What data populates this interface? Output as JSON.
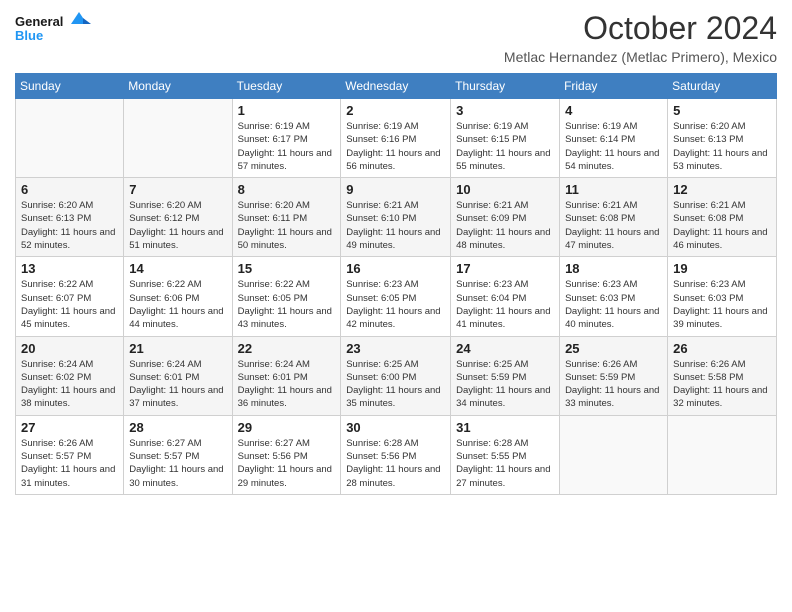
{
  "logo": {
    "line1": "General",
    "line2": "Blue"
  },
  "header": {
    "month": "October 2024",
    "subtitle": "Metlac Hernandez (Metlac Primero), Mexico"
  },
  "weekdays": [
    "Sunday",
    "Monday",
    "Tuesday",
    "Wednesday",
    "Thursday",
    "Friday",
    "Saturday"
  ],
  "weeks": [
    [
      {
        "day": "",
        "info": ""
      },
      {
        "day": "",
        "info": ""
      },
      {
        "day": "1",
        "info": "Sunrise: 6:19 AM\nSunset: 6:17 PM\nDaylight: 11 hours and 57 minutes."
      },
      {
        "day": "2",
        "info": "Sunrise: 6:19 AM\nSunset: 6:16 PM\nDaylight: 11 hours and 56 minutes."
      },
      {
        "day": "3",
        "info": "Sunrise: 6:19 AM\nSunset: 6:15 PM\nDaylight: 11 hours and 55 minutes."
      },
      {
        "day": "4",
        "info": "Sunrise: 6:19 AM\nSunset: 6:14 PM\nDaylight: 11 hours and 54 minutes."
      },
      {
        "day": "5",
        "info": "Sunrise: 6:20 AM\nSunset: 6:13 PM\nDaylight: 11 hours and 53 minutes."
      }
    ],
    [
      {
        "day": "6",
        "info": "Sunrise: 6:20 AM\nSunset: 6:13 PM\nDaylight: 11 hours and 52 minutes."
      },
      {
        "day": "7",
        "info": "Sunrise: 6:20 AM\nSunset: 6:12 PM\nDaylight: 11 hours and 51 minutes."
      },
      {
        "day": "8",
        "info": "Sunrise: 6:20 AM\nSunset: 6:11 PM\nDaylight: 11 hours and 50 minutes."
      },
      {
        "day": "9",
        "info": "Sunrise: 6:21 AM\nSunset: 6:10 PM\nDaylight: 11 hours and 49 minutes."
      },
      {
        "day": "10",
        "info": "Sunrise: 6:21 AM\nSunset: 6:09 PM\nDaylight: 11 hours and 48 minutes."
      },
      {
        "day": "11",
        "info": "Sunrise: 6:21 AM\nSunset: 6:08 PM\nDaylight: 11 hours and 47 minutes."
      },
      {
        "day": "12",
        "info": "Sunrise: 6:21 AM\nSunset: 6:08 PM\nDaylight: 11 hours and 46 minutes."
      }
    ],
    [
      {
        "day": "13",
        "info": "Sunrise: 6:22 AM\nSunset: 6:07 PM\nDaylight: 11 hours and 45 minutes."
      },
      {
        "day": "14",
        "info": "Sunrise: 6:22 AM\nSunset: 6:06 PM\nDaylight: 11 hours and 44 minutes."
      },
      {
        "day": "15",
        "info": "Sunrise: 6:22 AM\nSunset: 6:05 PM\nDaylight: 11 hours and 43 minutes."
      },
      {
        "day": "16",
        "info": "Sunrise: 6:23 AM\nSunset: 6:05 PM\nDaylight: 11 hours and 42 minutes."
      },
      {
        "day": "17",
        "info": "Sunrise: 6:23 AM\nSunset: 6:04 PM\nDaylight: 11 hours and 41 minutes."
      },
      {
        "day": "18",
        "info": "Sunrise: 6:23 AM\nSunset: 6:03 PM\nDaylight: 11 hours and 40 minutes."
      },
      {
        "day": "19",
        "info": "Sunrise: 6:23 AM\nSunset: 6:03 PM\nDaylight: 11 hours and 39 minutes."
      }
    ],
    [
      {
        "day": "20",
        "info": "Sunrise: 6:24 AM\nSunset: 6:02 PM\nDaylight: 11 hours and 38 minutes."
      },
      {
        "day": "21",
        "info": "Sunrise: 6:24 AM\nSunset: 6:01 PM\nDaylight: 11 hours and 37 minutes."
      },
      {
        "day": "22",
        "info": "Sunrise: 6:24 AM\nSunset: 6:01 PM\nDaylight: 11 hours and 36 minutes."
      },
      {
        "day": "23",
        "info": "Sunrise: 6:25 AM\nSunset: 6:00 PM\nDaylight: 11 hours and 35 minutes."
      },
      {
        "day": "24",
        "info": "Sunrise: 6:25 AM\nSunset: 5:59 PM\nDaylight: 11 hours and 34 minutes."
      },
      {
        "day": "25",
        "info": "Sunrise: 6:26 AM\nSunset: 5:59 PM\nDaylight: 11 hours and 33 minutes."
      },
      {
        "day": "26",
        "info": "Sunrise: 6:26 AM\nSunset: 5:58 PM\nDaylight: 11 hours and 32 minutes."
      }
    ],
    [
      {
        "day": "27",
        "info": "Sunrise: 6:26 AM\nSunset: 5:57 PM\nDaylight: 11 hours and 31 minutes."
      },
      {
        "day": "28",
        "info": "Sunrise: 6:27 AM\nSunset: 5:57 PM\nDaylight: 11 hours and 30 minutes."
      },
      {
        "day": "29",
        "info": "Sunrise: 6:27 AM\nSunset: 5:56 PM\nDaylight: 11 hours and 29 minutes."
      },
      {
        "day": "30",
        "info": "Sunrise: 6:28 AM\nSunset: 5:56 PM\nDaylight: 11 hours and 28 minutes."
      },
      {
        "day": "31",
        "info": "Sunrise: 6:28 AM\nSunset: 5:55 PM\nDaylight: 11 hours and 27 minutes."
      },
      {
        "day": "",
        "info": ""
      },
      {
        "day": "",
        "info": ""
      }
    ]
  ]
}
